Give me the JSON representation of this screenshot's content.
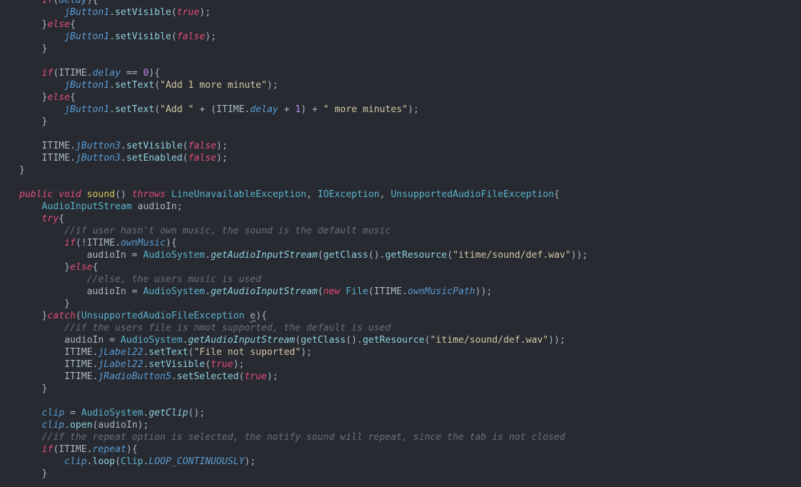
{
  "editor": {
    "language": "java",
    "lines": [
      {
        "indent": 1,
        "tokens": [
          {
            "t": "if",
            "c": "kw"
          },
          {
            "t": "(",
            "c": "plain"
          },
          {
            "t": "delay",
            "c": "field"
          },
          {
            "t": "){",
            "c": "plain"
          }
        ]
      },
      {
        "indent": 2,
        "tokens": [
          {
            "t": "jButton1",
            "c": "field"
          },
          {
            "t": ".",
            "c": "plain"
          },
          {
            "t": "setVisible",
            "c": "method"
          },
          {
            "t": "(",
            "c": "plain"
          },
          {
            "t": "true",
            "c": "bool"
          },
          {
            "t": ");",
            "c": "plain"
          }
        ]
      },
      {
        "indent": 1,
        "tokens": [
          {
            "t": "}",
            "c": "plain"
          },
          {
            "t": "else",
            "c": "kw"
          },
          {
            "t": "{",
            "c": "plain"
          }
        ]
      },
      {
        "indent": 2,
        "tokens": [
          {
            "t": "jButton1",
            "c": "field"
          },
          {
            "t": ".",
            "c": "plain"
          },
          {
            "t": "setVisible",
            "c": "method"
          },
          {
            "t": "(",
            "c": "plain"
          },
          {
            "t": "false",
            "c": "bool"
          },
          {
            "t": ");",
            "c": "plain"
          }
        ]
      },
      {
        "indent": 1,
        "tokens": [
          {
            "t": "}",
            "c": "plain"
          }
        ]
      },
      {
        "indent": 0,
        "tokens": []
      },
      {
        "indent": 1,
        "tokens": [
          {
            "t": "if",
            "c": "kw"
          },
          {
            "t": "(",
            "c": "plain"
          },
          {
            "t": "ITIME",
            "c": "ident"
          },
          {
            "t": ".",
            "c": "plain"
          },
          {
            "t": "delay",
            "c": "field"
          },
          {
            "t": " == ",
            "c": "plain"
          },
          {
            "t": "0",
            "c": "num"
          },
          {
            "t": "){",
            "c": "plain"
          }
        ]
      },
      {
        "indent": 2,
        "tokens": [
          {
            "t": "jButton1",
            "c": "field"
          },
          {
            "t": ".",
            "c": "plain"
          },
          {
            "t": "setText",
            "c": "method"
          },
          {
            "t": "(",
            "c": "plain"
          },
          {
            "t": "\"Add 1 more minute\"",
            "c": "str"
          },
          {
            "t": ");",
            "c": "plain"
          }
        ]
      },
      {
        "indent": 1,
        "tokens": [
          {
            "t": "}",
            "c": "plain"
          },
          {
            "t": "else",
            "c": "kw"
          },
          {
            "t": "{",
            "c": "plain"
          }
        ]
      },
      {
        "indent": 2,
        "tokens": [
          {
            "t": "jButton1",
            "c": "field"
          },
          {
            "t": ".",
            "c": "plain"
          },
          {
            "t": "setText",
            "c": "method"
          },
          {
            "t": "(",
            "c": "plain"
          },
          {
            "t": "\"Add \"",
            "c": "str"
          },
          {
            "t": " + (",
            "c": "plain"
          },
          {
            "t": "ITIME",
            "c": "ident"
          },
          {
            "t": ".",
            "c": "plain"
          },
          {
            "t": "delay",
            "c": "field"
          },
          {
            "t": " + ",
            "c": "plain"
          },
          {
            "t": "1",
            "c": "num"
          },
          {
            "t": ") + ",
            "c": "plain"
          },
          {
            "t": "\" more minutes\"",
            "c": "str"
          },
          {
            "t": ");",
            "c": "plain"
          }
        ]
      },
      {
        "indent": 1,
        "tokens": [
          {
            "t": "}",
            "c": "plain"
          }
        ]
      },
      {
        "indent": 0,
        "tokens": []
      },
      {
        "indent": 1,
        "tokens": [
          {
            "t": "ITIME",
            "c": "ident"
          },
          {
            "t": ".",
            "c": "plain"
          },
          {
            "t": "jButton3",
            "c": "field"
          },
          {
            "t": ".",
            "c": "plain"
          },
          {
            "t": "setVisible",
            "c": "method"
          },
          {
            "t": "(",
            "c": "plain"
          },
          {
            "t": "false",
            "c": "bool"
          },
          {
            "t": ");",
            "c": "plain"
          }
        ]
      },
      {
        "indent": 1,
        "tokens": [
          {
            "t": "ITIME",
            "c": "ident"
          },
          {
            "t": ".",
            "c": "plain"
          },
          {
            "t": "jButton3",
            "c": "field"
          },
          {
            "t": ".",
            "c": "plain"
          },
          {
            "t": "setEnabled",
            "c": "method"
          },
          {
            "t": "(",
            "c": "plain"
          },
          {
            "t": "false",
            "c": "bool"
          },
          {
            "t": ");",
            "c": "plain"
          }
        ]
      },
      {
        "indent": 0,
        "tokens": [
          {
            "t": "}",
            "c": "plain"
          }
        ]
      },
      {
        "indent": 0,
        "tokens": []
      },
      {
        "indent": 0,
        "tokens": [
          {
            "t": "public",
            "c": "kw"
          },
          {
            "t": " ",
            "c": "plain"
          },
          {
            "t": "void",
            "c": "kw"
          },
          {
            "t": " ",
            "c": "plain"
          },
          {
            "t": "sound",
            "c": "fn-def"
          },
          {
            "t": "() ",
            "c": "plain"
          },
          {
            "t": "throws",
            "c": "kw"
          },
          {
            "t": " ",
            "c": "plain"
          },
          {
            "t": "LineUnavailableException",
            "c": "type"
          },
          {
            "t": ", ",
            "c": "plain"
          },
          {
            "t": "IOException",
            "c": "type"
          },
          {
            "t": ", ",
            "c": "plain"
          },
          {
            "t": "UnsupportedAudioFileException",
            "c": "type"
          },
          {
            "t": "{",
            "c": "plain"
          }
        ]
      },
      {
        "indent": 1,
        "tokens": [
          {
            "t": "AudioInputStream",
            "c": "type"
          },
          {
            "t": " audioIn;",
            "c": "plain"
          }
        ]
      },
      {
        "indent": 1,
        "tokens": [
          {
            "t": "try",
            "c": "kw"
          },
          {
            "t": "{",
            "c": "plain"
          }
        ]
      },
      {
        "indent": 2,
        "tokens": [
          {
            "t": "//if user hasn't own music, the sound is the default music",
            "c": "comment"
          }
        ]
      },
      {
        "indent": 2,
        "tokens": [
          {
            "t": "if",
            "c": "kw"
          },
          {
            "t": "(!",
            "c": "plain"
          },
          {
            "t": "ITIME",
            "c": "ident"
          },
          {
            "t": ".",
            "c": "plain"
          },
          {
            "t": "ownMusic",
            "c": "field"
          },
          {
            "t": "){",
            "c": "plain"
          }
        ]
      },
      {
        "indent": 3,
        "tokens": [
          {
            "t": "audioIn",
            "c": "var"
          },
          {
            "t": " = ",
            "c": "plain"
          },
          {
            "t": "AudioSystem",
            "c": "type"
          },
          {
            "t": ".",
            "c": "plain"
          },
          {
            "t": "getAudioInputStream",
            "c": "smethod"
          },
          {
            "t": "(",
            "c": "plain"
          },
          {
            "t": "getClass",
            "c": "method"
          },
          {
            "t": "().",
            "c": "plain"
          },
          {
            "t": "getResource",
            "c": "method"
          },
          {
            "t": "(",
            "c": "plain"
          },
          {
            "t": "\"itime/sound/def.wav\"",
            "c": "str"
          },
          {
            "t": "));",
            "c": "plain"
          }
        ]
      },
      {
        "indent": 2,
        "tokens": [
          {
            "t": "}",
            "c": "plain"
          },
          {
            "t": "else",
            "c": "kw"
          },
          {
            "t": "{",
            "c": "plain"
          }
        ]
      },
      {
        "indent": 3,
        "tokens": [
          {
            "t": "//else, the users music is used",
            "c": "comment"
          }
        ]
      },
      {
        "indent": 3,
        "tokens": [
          {
            "t": "audioIn",
            "c": "var"
          },
          {
            "t": " = ",
            "c": "plain"
          },
          {
            "t": "AudioSystem",
            "c": "type"
          },
          {
            "t": ".",
            "c": "plain"
          },
          {
            "t": "getAudioInputStream",
            "c": "smethod"
          },
          {
            "t": "(",
            "c": "plain"
          },
          {
            "t": "new",
            "c": "kw"
          },
          {
            "t": " ",
            "c": "plain"
          },
          {
            "t": "File",
            "c": "type"
          },
          {
            "t": "(",
            "c": "plain"
          },
          {
            "t": "ITIME",
            "c": "ident"
          },
          {
            "t": ".",
            "c": "plain"
          },
          {
            "t": "ownMusicPath",
            "c": "field"
          },
          {
            "t": "));",
            "c": "plain"
          }
        ]
      },
      {
        "indent": 2,
        "tokens": [
          {
            "t": "}",
            "c": "plain"
          }
        ]
      },
      {
        "indent": 1,
        "tokens": [
          {
            "t": "}",
            "c": "plain"
          },
          {
            "t": "catch",
            "c": "kw"
          },
          {
            "t": "(",
            "c": "plain"
          },
          {
            "t": "UnsupportedAudioFileException",
            "c": "type"
          },
          {
            "t": " ",
            "c": "plain"
          },
          {
            "t": "e",
            "c": "var underline"
          },
          {
            "t": "){",
            "c": "plain"
          }
        ]
      },
      {
        "indent": 2,
        "tokens": [
          {
            "t": "//if the users file is nmot supported, the default is used",
            "c": "comment"
          }
        ]
      },
      {
        "indent": 2,
        "tokens": [
          {
            "t": "audioIn",
            "c": "var"
          },
          {
            "t": " = ",
            "c": "plain"
          },
          {
            "t": "AudioSystem",
            "c": "type"
          },
          {
            "t": ".",
            "c": "plain"
          },
          {
            "t": "getAudioInputStream",
            "c": "smethod"
          },
          {
            "t": "(",
            "c": "plain"
          },
          {
            "t": "getClass",
            "c": "method"
          },
          {
            "t": "().",
            "c": "plain"
          },
          {
            "t": "getResource",
            "c": "method"
          },
          {
            "t": "(",
            "c": "plain"
          },
          {
            "t": "\"itime/sound/def.wav\"",
            "c": "str"
          },
          {
            "t": "));",
            "c": "plain"
          }
        ]
      },
      {
        "indent": 2,
        "tokens": [
          {
            "t": "ITIME",
            "c": "ident"
          },
          {
            "t": ".",
            "c": "plain"
          },
          {
            "t": "jLabel22",
            "c": "field"
          },
          {
            "t": ".",
            "c": "plain"
          },
          {
            "t": "setText",
            "c": "method"
          },
          {
            "t": "(",
            "c": "plain"
          },
          {
            "t": "\"File not suported\"",
            "c": "str"
          },
          {
            "t": ");",
            "c": "plain"
          }
        ]
      },
      {
        "indent": 2,
        "tokens": [
          {
            "t": "ITIME",
            "c": "ident"
          },
          {
            "t": ".",
            "c": "plain"
          },
          {
            "t": "jLabel22",
            "c": "field"
          },
          {
            "t": ".",
            "c": "plain"
          },
          {
            "t": "setVisible",
            "c": "method"
          },
          {
            "t": "(",
            "c": "plain"
          },
          {
            "t": "true",
            "c": "bool"
          },
          {
            "t": ");",
            "c": "plain"
          }
        ]
      },
      {
        "indent": 2,
        "tokens": [
          {
            "t": "ITIME",
            "c": "ident"
          },
          {
            "t": ".",
            "c": "plain"
          },
          {
            "t": "jRadioButton5",
            "c": "field"
          },
          {
            "t": ".",
            "c": "plain"
          },
          {
            "t": "setSelected",
            "c": "method"
          },
          {
            "t": "(",
            "c": "plain"
          },
          {
            "t": "true",
            "c": "bool"
          },
          {
            "t": ");",
            "c": "plain"
          }
        ]
      },
      {
        "indent": 1,
        "tokens": [
          {
            "t": "}",
            "c": "plain"
          }
        ]
      },
      {
        "indent": 0,
        "tokens": []
      },
      {
        "indent": 1,
        "tokens": [
          {
            "t": "clip",
            "c": "field"
          },
          {
            "t": " = ",
            "c": "plain"
          },
          {
            "t": "AudioSystem",
            "c": "type"
          },
          {
            "t": ".",
            "c": "plain"
          },
          {
            "t": "getClip",
            "c": "smethod"
          },
          {
            "t": "();",
            "c": "plain"
          }
        ]
      },
      {
        "indent": 1,
        "tokens": [
          {
            "t": "clip",
            "c": "field"
          },
          {
            "t": ".",
            "c": "plain"
          },
          {
            "t": "open",
            "c": "method"
          },
          {
            "t": "(",
            "c": "plain"
          },
          {
            "t": "audioIn",
            "c": "var"
          },
          {
            "t": ");",
            "c": "plain"
          }
        ]
      },
      {
        "indent": 1,
        "tokens": [
          {
            "t": "//if the repeat option is selected, the notify sound will repeat, since the tab is not closed",
            "c": "comment"
          }
        ]
      },
      {
        "indent": 1,
        "tokens": [
          {
            "t": "if",
            "c": "kw"
          },
          {
            "t": "(",
            "c": "plain"
          },
          {
            "t": "ITIME",
            "c": "ident"
          },
          {
            "t": ".",
            "c": "plain"
          },
          {
            "t": "repeat",
            "c": "field"
          },
          {
            "t": "){",
            "c": "plain"
          }
        ]
      },
      {
        "indent": 2,
        "tokens": [
          {
            "t": "clip",
            "c": "field"
          },
          {
            "t": ".",
            "c": "plain"
          },
          {
            "t": "loop",
            "c": "method"
          },
          {
            "t": "(",
            "c": "plain"
          },
          {
            "t": "Clip",
            "c": "type"
          },
          {
            "t": ".",
            "c": "plain"
          },
          {
            "t": "LOOP_CONTINUOUSLY",
            "c": "const"
          },
          {
            "t": ");",
            "c": "plain"
          }
        ]
      },
      {
        "indent": 1,
        "tokens": [
          {
            "t": "}",
            "c": "plain"
          }
        ]
      }
    ]
  }
}
